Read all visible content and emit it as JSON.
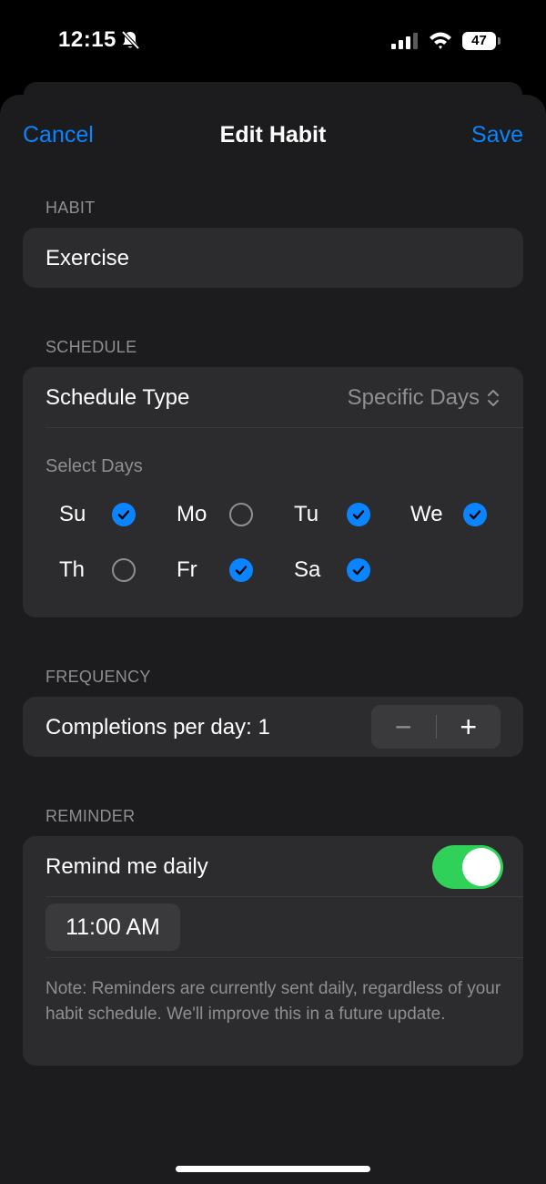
{
  "status_bar": {
    "time": "12:15",
    "battery": "47",
    "icons": [
      "bell-slash-icon",
      "cellular-signal-icon",
      "wifi-icon",
      "battery-icon"
    ]
  },
  "nav": {
    "cancel": "Cancel",
    "title": "Edit Habit",
    "save": "Save",
    "accent_color": "#0a84ff"
  },
  "habit": {
    "header": "HABIT",
    "name": "Exercise"
  },
  "schedule": {
    "header": "SCHEDULE",
    "type_label": "Schedule Type",
    "type_value": "Specific Days",
    "select_days_label": "Select Days",
    "days": [
      {
        "label": "Su",
        "selected": true
      },
      {
        "label": "Mo",
        "selected": false
      },
      {
        "label": "Tu",
        "selected": true
      },
      {
        "label": "We",
        "selected": true
      },
      {
        "label": "Th",
        "selected": false
      },
      {
        "label": "Fr",
        "selected": true
      },
      {
        "label": "Sa",
        "selected": true
      }
    ]
  },
  "frequency": {
    "header": "FREQUENCY",
    "label": "Completions per day: 1",
    "minus": "−",
    "plus": "+"
  },
  "reminder": {
    "header": "REMINDER",
    "label": "Remind me daily",
    "enabled": true,
    "toggle_color": "#30d158",
    "time": "11:00 AM",
    "note": "Note: Reminders are currently sent daily, regardless of your habit schedule. We'll improve this in a future update."
  }
}
